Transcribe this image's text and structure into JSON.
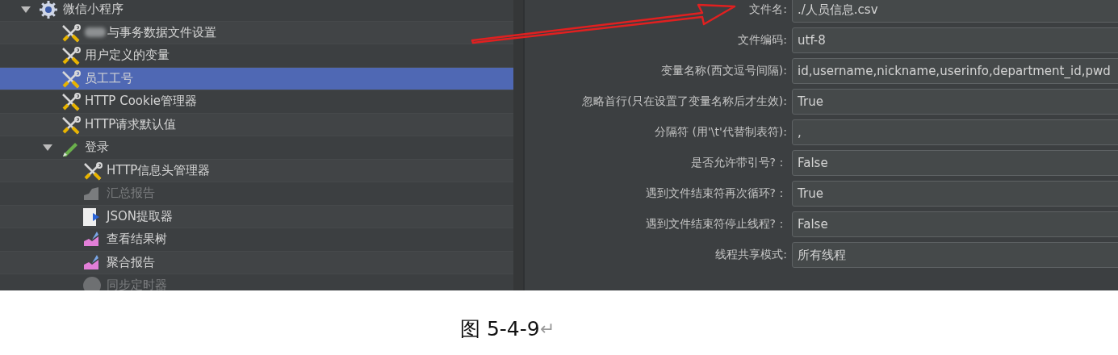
{
  "tree": {
    "label": "微信小程序",
    "kind": "plan",
    "expanded": true,
    "selected": false,
    "disabled": false,
    "children": [
      {
        "label": "与事务数据文件设置",
        "kind": "config",
        "redacted": true,
        "selected": false,
        "disabled": false
      },
      {
        "label": "用户定义的变量",
        "kind": "config",
        "selected": false,
        "disabled": false
      },
      {
        "label": "员工工号",
        "kind": "config",
        "selected": true,
        "disabled": false
      },
      {
        "label": "HTTP Cookie管理器",
        "kind": "config",
        "selected": false,
        "disabled": false
      },
      {
        "label": "HTTP请求默认值",
        "kind": "config",
        "selected": false,
        "disabled": false
      },
      {
        "label": "登录",
        "kind": "sampler",
        "expanded": true,
        "selected": false,
        "disabled": false,
        "children": [
          {
            "label": "HTTP信息头管理器",
            "kind": "config",
            "selected": false,
            "disabled": false
          },
          {
            "label": "汇总报告",
            "kind": "report",
            "selected": false,
            "disabled": true
          },
          {
            "label": "JSON提取器",
            "kind": "extractor",
            "selected": false,
            "disabled": false
          },
          {
            "label": "查看结果树",
            "kind": "listener",
            "selected": false,
            "disabled": false
          },
          {
            "label": "聚合报告",
            "kind": "listener",
            "selected": false,
            "disabled": false
          },
          {
            "label": "同步定时器",
            "kind": "timer",
            "selected": false,
            "disabled": true
          }
        ]
      }
    ]
  },
  "form": {
    "fields": [
      {
        "label": "文件名:",
        "value": "./人员信息.csv"
      },
      {
        "label": "文件编码:",
        "value": "utf-8"
      },
      {
        "label": "变量名称(西文逗号间隔):",
        "value": "id,username,nickname,userinfo,department_id,pwd"
      },
      {
        "label": "忽略首行(只在设置了变量名称后才生效):",
        "value": "True"
      },
      {
        "label": "分隔符 (用'\\t'代替制表符):",
        "value": ","
      },
      {
        "label": "是否允许带引号?：",
        "value": "False"
      },
      {
        "label": "遇到文件结束符再次循环?：",
        "value": "True"
      },
      {
        "label": "遇到文件结束符停止线程?：",
        "value": "False"
      },
      {
        "label": "线程共享模式:",
        "value": "所有线程"
      }
    ]
  },
  "caption": {
    "text": "图 5-4-9",
    "paragraph_mark": "↵"
  }
}
